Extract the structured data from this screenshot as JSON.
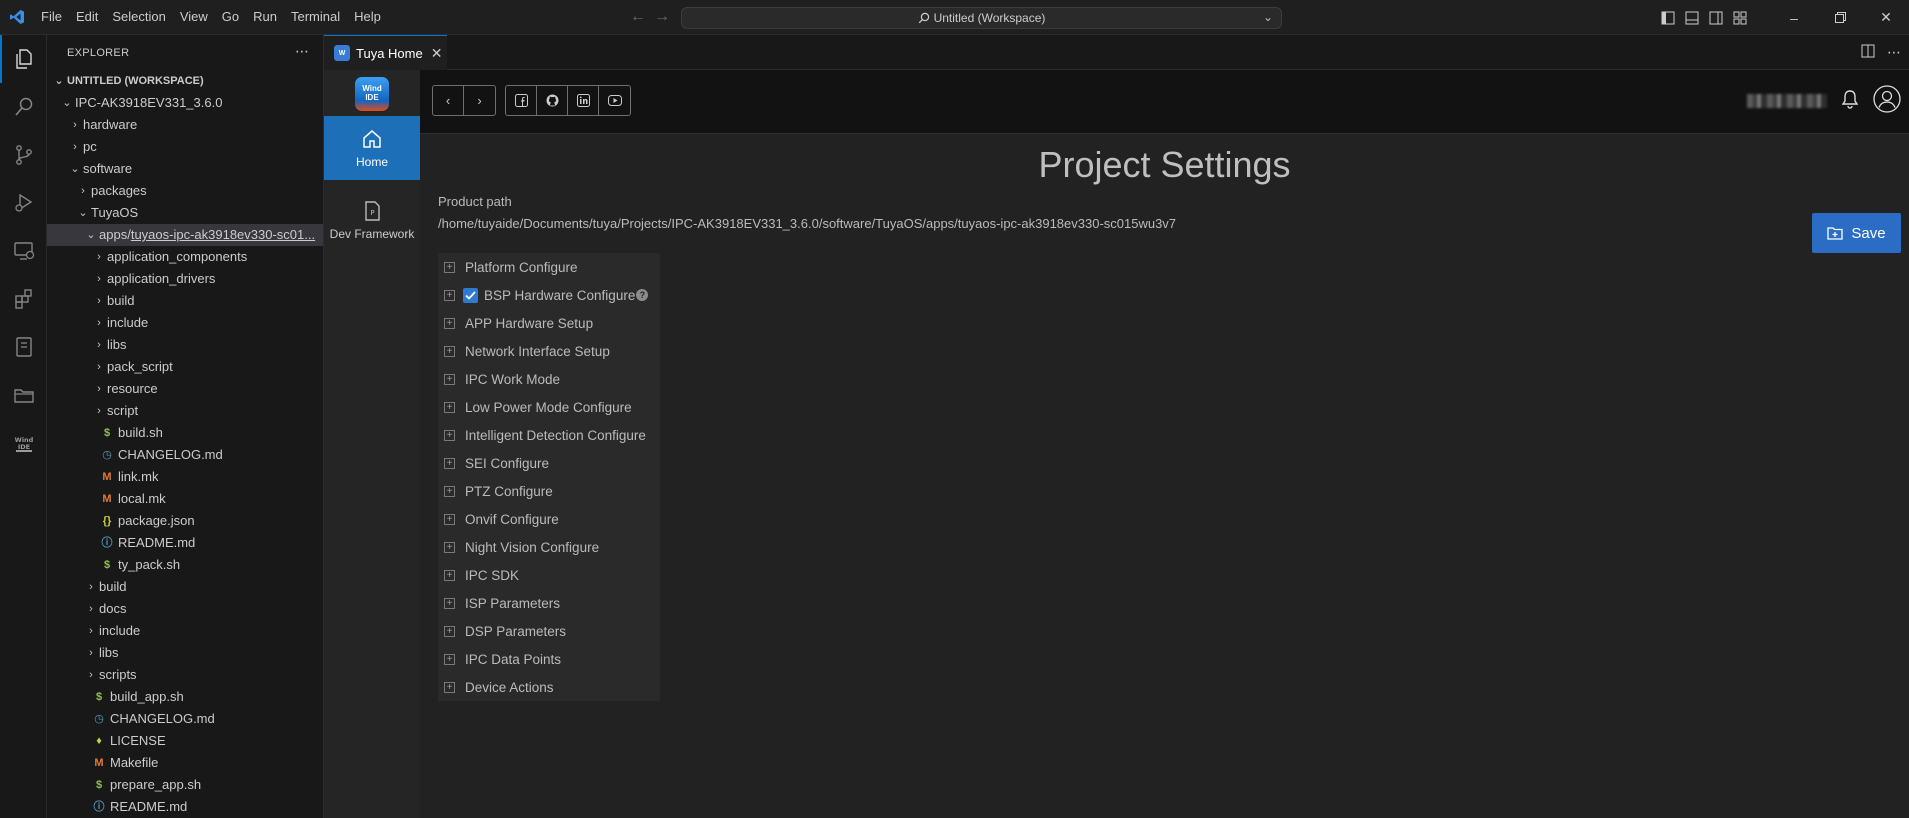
{
  "menubar": {
    "items": [
      "File",
      "Edit",
      "Selection",
      "View",
      "Go",
      "Run",
      "Terminal",
      "Help"
    ]
  },
  "command_center": {
    "text": "Untitled (Workspace)"
  },
  "activity_bar": {
    "items": [
      "explorer",
      "search",
      "source-control",
      "run-debug",
      "remote-explorer",
      "extensions",
      "notebook",
      "file-manager",
      "wind-ide"
    ]
  },
  "sidebar": {
    "title": "EXPLORER",
    "workspace": "UNTITLED (WORKSPACE)",
    "tree": [
      {
        "label": "IPC-AK3918EV331_3.6.0",
        "kind": "folder-open",
        "depth": 1
      },
      {
        "label": "hardware",
        "kind": "folder",
        "depth": 2
      },
      {
        "label": "pc",
        "kind": "folder",
        "depth": 2
      },
      {
        "label": "software",
        "kind": "folder-open",
        "depth": 2
      },
      {
        "label": "packages",
        "kind": "folder",
        "depth": 3
      },
      {
        "label": "TuyaOS",
        "kind": "folder-open",
        "depth": 3
      },
      {
        "label": "apps",
        "suffix": "tuyaos-ipc-ak3918ev330-sc01...",
        "kind": "folder-open",
        "depth": 4,
        "selected": true
      },
      {
        "label": "application_components",
        "kind": "folder",
        "depth": 5
      },
      {
        "label": "application_drivers",
        "kind": "folder",
        "depth": 5
      },
      {
        "label": "build",
        "kind": "folder",
        "depth": 5
      },
      {
        "label": "include",
        "kind": "folder",
        "depth": 5
      },
      {
        "label": "libs",
        "kind": "folder",
        "depth": 5
      },
      {
        "label": "pack_script",
        "kind": "folder",
        "depth": 5
      },
      {
        "label": "resource",
        "kind": "folder",
        "depth": 5
      },
      {
        "label": "script",
        "kind": "folder",
        "depth": 5
      },
      {
        "label": "build.sh",
        "kind": "sh",
        "depth": 5
      },
      {
        "label": "CHANGELOG.md",
        "kind": "md",
        "depth": 5
      },
      {
        "label": "link.mk",
        "kind": "mk",
        "depth": 5
      },
      {
        "label": "local.mk",
        "kind": "mk",
        "depth": 5
      },
      {
        "label": "package.json",
        "kind": "json",
        "depth": 5
      },
      {
        "label": "README.md",
        "kind": "info",
        "depth": 5
      },
      {
        "label": "ty_pack.sh",
        "kind": "sh",
        "depth": 5
      },
      {
        "label": "build",
        "kind": "folder",
        "depth": 4
      },
      {
        "label": "docs",
        "kind": "folder",
        "depth": 4
      },
      {
        "label": "include",
        "kind": "folder",
        "depth": 4
      },
      {
        "label": "libs",
        "kind": "folder",
        "depth": 4
      },
      {
        "label": "scripts",
        "kind": "folder",
        "depth": 4
      },
      {
        "label": "build_app.sh",
        "kind": "sh",
        "depth": 4
      },
      {
        "label": "CHANGELOG.md",
        "kind": "md",
        "depth": 4
      },
      {
        "label": "LICENSE",
        "kind": "lic",
        "depth": 4
      },
      {
        "label": "Makefile",
        "kind": "mk",
        "depth": 4
      },
      {
        "label": "prepare_app.sh",
        "kind": "sh",
        "depth": 4
      },
      {
        "label": "README.md",
        "kind": "info",
        "depth": 4
      }
    ]
  },
  "tab": {
    "label": "Tuya Home"
  },
  "web_nav": {
    "brand": "Wind IDE",
    "home": "Home",
    "framework": "Dev Framework"
  },
  "page": {
    "title": "Project Settings",
    "product_path_label": "Product path",
    "product_path": "/home/tuyaide/Documents/tuya/Projects/IPC-AK3918EV331_3.6.0/software/TuyaOS/apps/tuyaos-ipc-ak3918ev330-sc015wu3v7",
    "save_label": "Save"
  },
  "config_items": [
    {
      "label": "Platform Configure",
      "checked": false
    },
    {
      "label": "BSP Hardware Configure",
      "checked": true,
      "help": true
    },
    {
      "label": "APP Hardware Setup",
      "checked": false
    },
    {
      "label": "Network Interface Setup",
      "checked": false
    },
    {
      "label": "IPC Work Mode",
      "checked": false
    },
    {
      "label": "Low Power Mode Configure",
      "checked": false
    },
    {
      "label": "Intelligent Detection Configure",
      "checked": false
    },
    {
      "label": "SEI Configure",
      "checked": false
    },
    {
      "label": "PTZ Configure",
      "checked": false
    },
    {
      "label": "Onvif Configure",
      "checked": false
    },
    {
      "label": "Night Vision Configure",
      "checked": false
    },
    {
      "label": "IPC SDK",
      "checked": false
    },
    {
      "label": "ISP Parameters",
      "checked": false
    },
    {
      "label": "DSP Parameters",
      "checked": false
    },
    {
      "label": "IPC Data Points",
      "checked": false
    },
    {
      "label": "Device Actions",
      "checked": false
    }
  ],
  "colors": {
    "accent": "#0078d4",
    "nav_active": "#1d6fb8",
    "save_button": "#2b6cc4"
  }
}
